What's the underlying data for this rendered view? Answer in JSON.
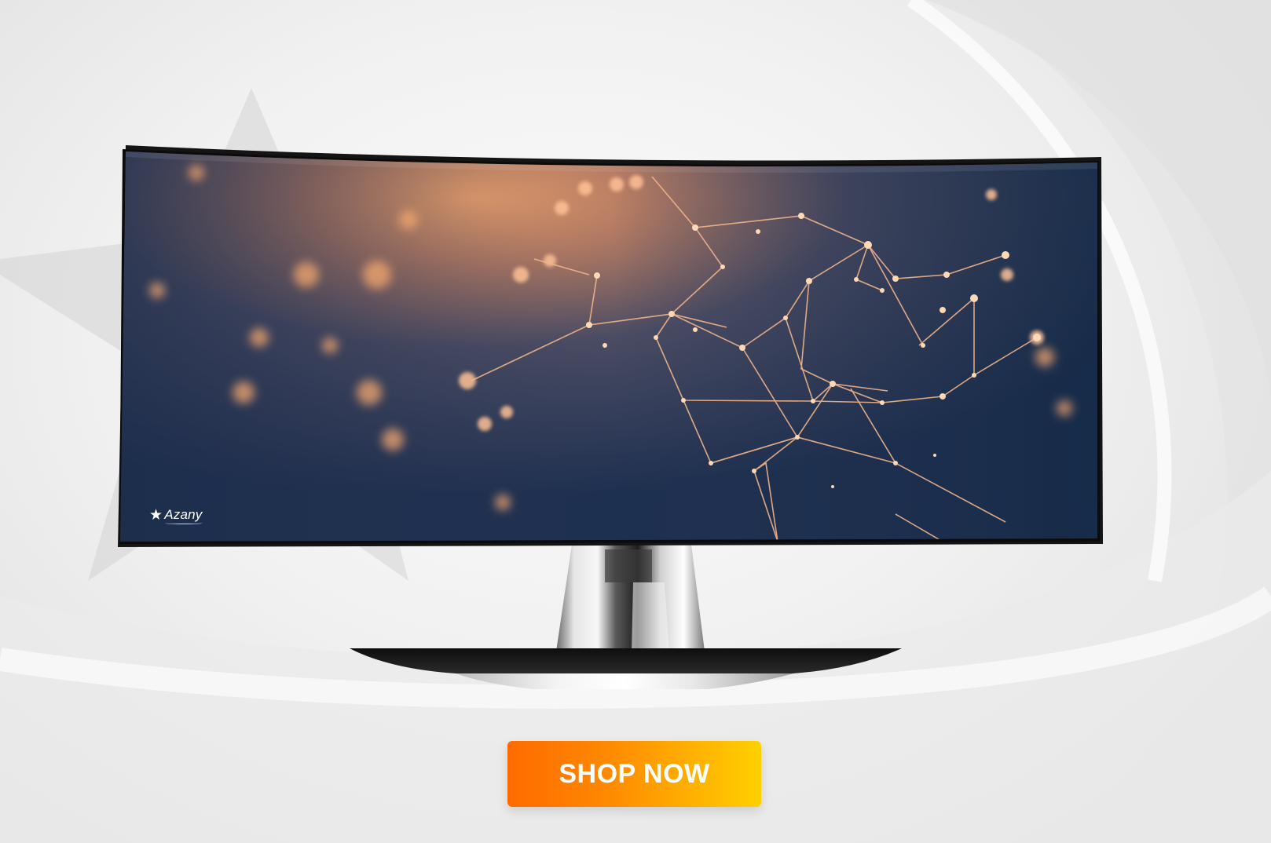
{
  "banner": {
    "brand_name": "Azany",
    "cta_label": "SHOP NOW"
  },
  "colors": {
    "cta_gradient_start": "#ff6a00",
    "cta_gradient_end": "#ffd000",
    "screen_background": "#1f3150",
    "screen_glow": "#f2a36b",
    "background": "#f1f1f1"
  },
  "icons": {
    "brand_star": "star-icon"
  }
}
